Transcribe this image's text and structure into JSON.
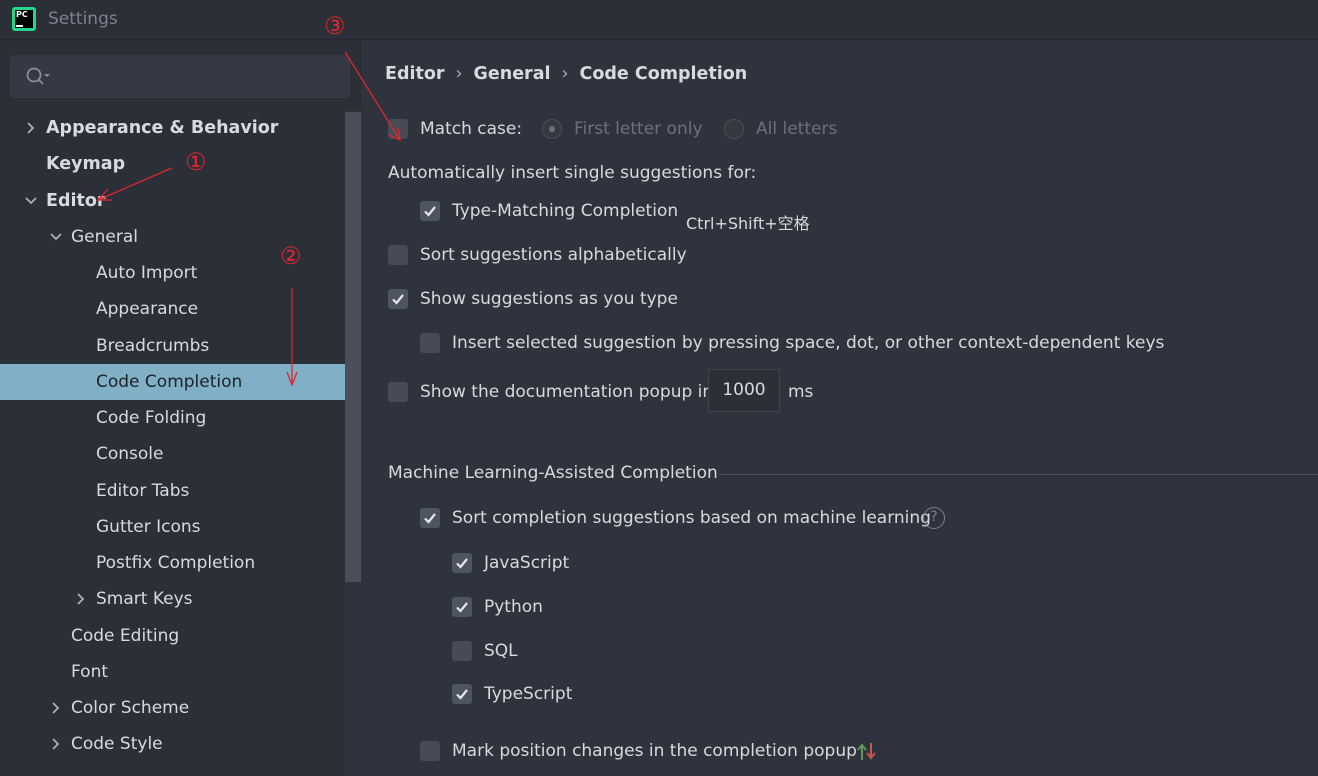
{
  "window": {
    "title": "Settings",
    "logo_text": "PC"
  },
  "search": {
    "placeholder": ""
  },
  "sidebar": {
    "items": [
      {
        "label": "Appearance & Behavior",
        "level": 0,
        "arrow": "right",
        "bold": true
      },
      {
        "label": "Keymap",
        "level": 0,
        "arrow": "none",
        "bold": true
      },
      {
        "label": "Editor",
        "level": 0,
        "arrow": "down",
        "bold": true
      },
      {
        "label": "General",
        "level": 1,
        "arrow": "down"
      },
      {
        "label": "Auto Import",
        "level": 2,
        "arrow": "none"
      },
      {
        "label": "Appearance",
        "level": 2,
        "arrow": "none"
      },
      {
        "label": "Breadcrumbs",
        "level": 2,
        "arrow": "none"
      },
      {
        "label": "Code Completion",
        "level": 2,
        "arrow": "none",
        "selected": true
      },
      {
        "label": "Code Folding",
        "level": 2,
        "arrow": "none"
      },
      {
        "label": "Console",
        "level": 2,
        "arrow": "none"
      },
      {
        "label": "Editor Tabs",
        "level": 2,
        "arrow": "none"
      },
      {
        "label": "Gutter Icons",
        "level": 2,
        "arrow": "none"
      },
      {
        "label": "Postfix Completion",
        "level": 2,
        "arrow": "none"
      },
      {
        "label": "Smart Keys",
        "level": 2,
        "arrow": "right"
      },
      {
        "label": "Code Editing",
        "level": 1,
        "arrow": "none"
      },
      {
        "label": "Font",
        "level": 1,
        "arrow": "none"
      },
      {
        "label": "Color Scheme",
        "level": 1,
        "arrow": "right"
      },
      {
        "label": "Code Style",
        "level": 1,
        "arrow": "right"
      }
    ]
  },
  "breadcrumb": {
    "items": [
      "Editor",
      "General",
      "Code Completion"
    ],
    "separator": "›"
  },
  "settings": {
    "match_case": {
      "label": "Match case:",
      "checked": false
    },
    "first_letter_only": {
      "label": "First letter only",
      "selected": true,
      "disabled": true
    },
    "all_letters": {
      "label": "All letters",
      "selected": false,
      "disabled": true
    },
    "auto_insert_heading": "Automatically insert single suggestions for:",
    "type_matching": {
      "label": "Type-Matching Completion",
      "checked": true,
      "shortcut": "Ctrl+Shift+空格"
    },
    "sort_alpha": {
      "label": "Sort suggestions alphabetically",
      "checked": false
    },
    "show_as_type": {
      "label": "Show suggestions as you type",
      "checked": true
    },
    "insert_selected": {
      "label": "Insert selected suggestion by pressing space, dot, or other context-dependent keys",
      "checked": false
    },
    "doc_popup": {
      "label": "Show the documentation popup in",
      "checked": false,
      "value": "1000",
      "unit": "ms"
    },
    "ml_section_title": "Machine Learning-Assisted Completion",
    "ml_sort": {
      "label": "Sort completion suggestions based on machine learning",
      "checked": true,
      "help_icon": "?"
    },
    "languages": [
      {
        "label": "JavaScript",
        "checked": true
      },
      {
        "label": "Python",
        "checked": true
      },
      {
        "label": "SQL",
        "checked": false
      },
      {
        "label": "TypeScript",
        "checked": true
      }
    ],
    "mark_position": {
      "label": "Mark position changes in the completion popup",
      "checked": false
    }
  },
  "annotations": {
    "marks": [
      "①",
      "②",
      "③"
    ],
    "color": "#e0262e"
  },
  "colors": {
    "selection": "#7fb0c5",
    "background": "#2f333d",
    "sidebar": "#2b2f38"
  }
}
